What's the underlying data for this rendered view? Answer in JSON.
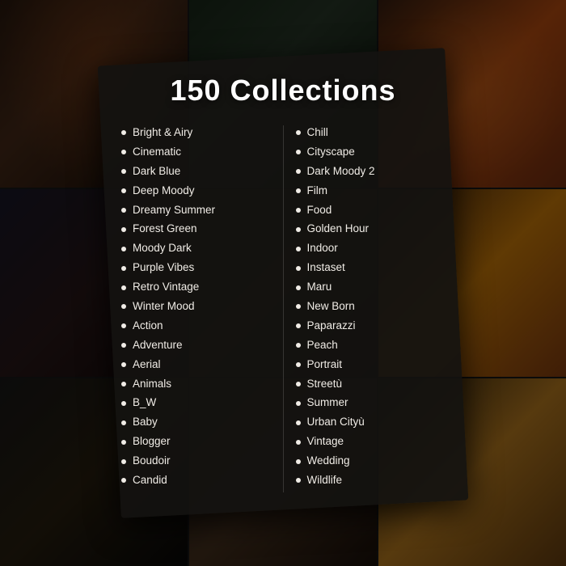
{
  "title": "150 Collections",
  "left_column": [
    "Bright & Airy",
    "Cinematic",
    "Dark Blue",
    "Deep Moody",
    "Dreamy Summer",
    "Forest Green",
    "Moody Dark",
    "Purple Vibes",
    "Retro Vintage",
    "Winter Mood",
    "Action",
    "Adventure",
    "Aerial",
    "Animals",
    "B_W",
    "Baby",
    "Blogger",
    "Boudoir",
    "Candid"
  ],
  "right_column": [
    "Chill",
    "Cityscape",
    "Dark Moody 2",
    "Film",
    "Food",
    "Golden Hour",
    "Indoor",
    "Instaset",
    "Maru",
    "New Born",
    "Paparazzi",
    "Peach",
    "Portrait",
    "Streetù",
    "Summer",
    "Urban Cityù",
    "Vintage",
    "Wedding",
    "Wildlife"
  ]
}
